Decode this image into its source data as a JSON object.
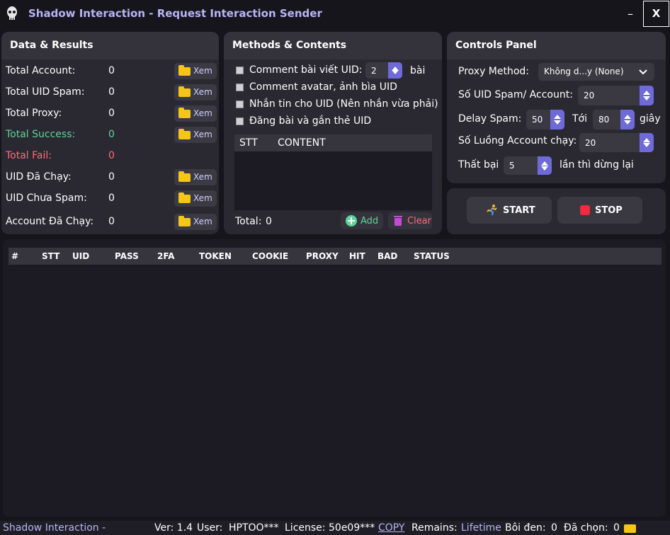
{
  "window": {
    "title": "Shadow Interaction - Request Interaction Sender",
    "minimize": "–",
    "close": "X"
  },
  "data_results": {
    "title": "Data & Results",
    "view_label": "Xem",
    "rows": [
      {
        "label": "Total Account:",
        "value": "0",
        "color": "#ffffff"
      },
      {
        "label": "Total UID Spam:",
        "value": "0",
        "color": "#ffffff"
      },
      {
        "label": "Total Proxy:",
        "value": "0",
        "color": "#ffffff"
      },
      {
        "label": "Total Success:",
        "value": "0",
        "color": "#5fd39a"
      },
      {
        "label": "Total Fail:",
        "value": "0",
        "color": "#ff6b7a"
      },
      {
        "label": "UID Đã Chạy:",
        "value": "0",
        "color": "#ffffff"
      },
      {
        "label": "UID Chưa Spam:",
        "value": "0",
        "color": "#ffffff"
      },
      {
        "label": "Account Đã Chạy:",
        "value": "0",
        "color": "#ffffff"
      }
    ]
  },
  "methods": {
    "title": "Methods & Contents",
    "options": [
      {
        "label": "Comment bài viết UID:",
        "checked": false
      },
      {
        "label": "Comment avatar, ảnh bìa UID",
        "checked": false
      },
      {
        "label": "Nhắn tin cho UID (Nên nhắn vừa phải)",
        "checked": false
      },
      {
        "label": "Đăng bài và gắn thẻ UID",
        "checked": false
      }
    ],
    "post_count": "2",
    "post_unit": "bài",
    "table_headers": [
      "STT",
      "CONTENT"
    ],
    "total_label": "Total:",
    "total_value": "0",
    "add_label": "Add",
    "clear_label": "Clear"
  },
  "controls": {
    "title": "Controls Panel",
    "proxy_label": "Proxy Method:",
    "proxy_value": "Không d...y (None)",
    "uid_per_account_label": "Số UID Spam/ Account:",
    "uid_per_account_value": "20",
    "delay_label": "Delay Spam:",
    "delay_from": "50",
    "delay_to_label": "Tới",
    "delay_to": "80",
    "delay_unit": "giây",
    "threads_label": "Số Luồng Account chạy:",
    "threads_value": "20",
    "fail_label": "Thất bại",
    "fail_value": "5",
    "fail_suffix": "lần thì dừng lại",
    "start_label": "START",
    "stop_label": "STOP"
  },
  "grid": {
    "columns": [
      "#",
      "STT",
      "UID",
      "PASS",
      "2FA",
      "TOKEN",
      "COOKIE",
      "PROXY",
      "HIT",
      "BAD",
      "STATUS"
    ],
    "rows": []
  },
  "statusbar": {
    "app_name": "Shadow Interaction -",
    "version": "Ver: 1.4",
    "user_label": "User:",
    "user_value": "HPTOO***",
    "license_label": "License:",
    "license_value": "50e09***",
    "copy_label": "COPY",
    "remains_label": "Remains:",
    "remains_value": "Lifetime",
    "blacklist_label": "Bôi đen:",
    "blacklist_value": "0",
    "selected_label": "Đã chọn:",
    "selected_value": "0"
  },
  "colors": {
    "accent": "#6e6ad8",
    "title": "#b9b4f5",
    "success": "#5fd39a",
    "fail": "#ff6b7a",
    "folder": "#f5c518",
    "add": "#5fd39a",
    "clear": "#ff6b7a"
  },
  "icons": {
    "app": "skull-icon",
    "folder": "folder-icon",
    "add": "plus-circle-icon",
    "clear": "trash-icon",
    "start": "runner-icon",
    "stop": "stop-square-icon"
  }
}
